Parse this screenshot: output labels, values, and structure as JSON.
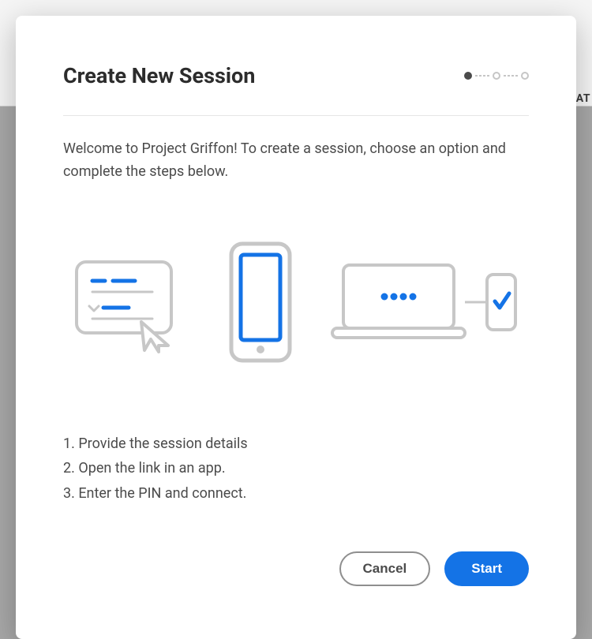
{
  "bg": {
    "partial_label": "EAT"
  },
  "modal": {
    "title": "Create New Session",
    "welcome": "Welcome to Project Griffon! To create a session, choose an option and complete the steps below.",
    "steps": {
      "s1": "1. Provide the session details",
      "s2": "2. Open the link in an app.",
      "s3": "3. Enter the PIN and connect."
    },
    "buttons": {
      "cancel": "Cancel",
      "start": "Start"
    }
  }
}
